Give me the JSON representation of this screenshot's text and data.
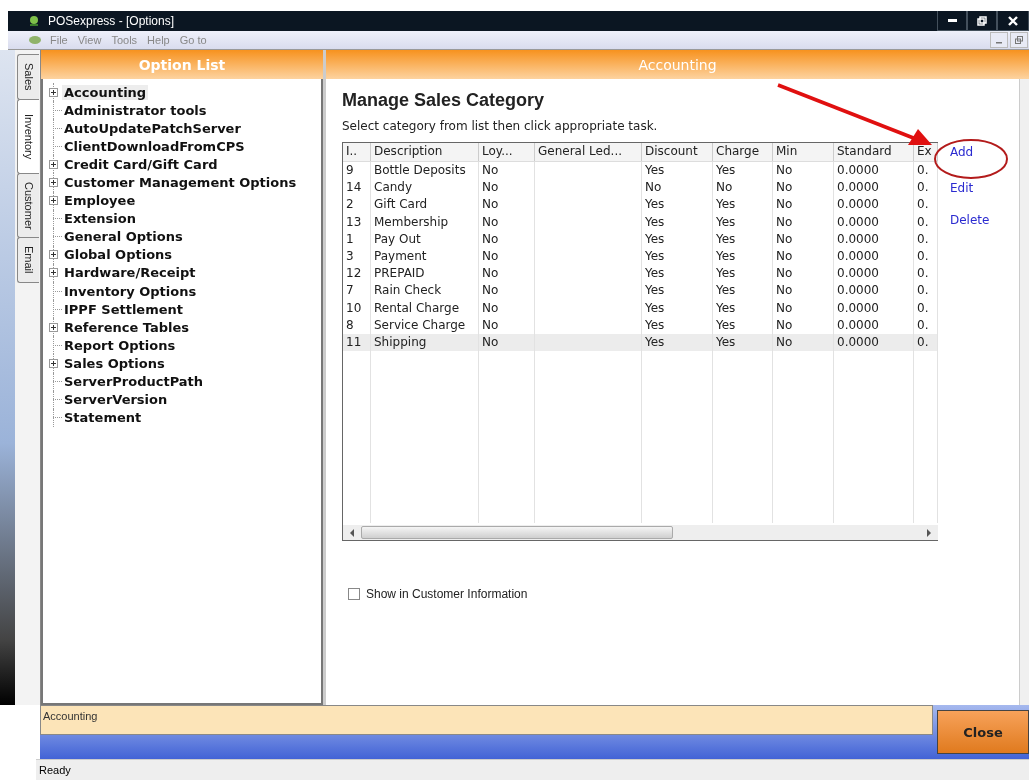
{
  "window": {
    "title": "POSexpress - [Options]"
  },
  "menu": [
    "File",
    "View",
    "Tools",
    "Help",
    "Go to"
  ],
  "side_tabs": [
    {
      "label": "Sales",
      "selected": false
    },
    {
      "label": "Inventory",
      "selected": true
    },
    {
      "label": "Customer",
      "selected": false
    },
    {
      "label": "Email",
      "selected": false
    }
  ],
  "option_list": {
    "title": "Option List",
    "items": [
      {
        "label": "Accounting",
        "expandable": true,
        "selected": true
      },
      {
        "label": "Administrator tools",
        "expandable": false,
        "selected": false
      },
      {
        "label": "AutoUpdatePatchServer",
        "expandable": false,
        "selected": false
      },
      {
        "label": "ClientDownloadFromCPS",
        "expandable": false,
        "selected": false
      },
      {
        "label": "Credit Card/Gift Card",
        "expandable": true,
        "selected": false
      },
      {
        "label": "Customer Management Options",
        "expandable": true,
        "selected": false
      },
      {
        "label": "Employee",
        "expandable": true,
        "selected": false
      },
      {
        "label": "Extension",
        "expandable": false,
        "selected": false
      },
      {
        "label": "General Options",
        "expandable": false,
        "selected": false
      },
      {
        "label": "Global Options",
        "expandable": true,
        "selected": false
      },
      {
        "label": "Hardware/Receipt",
        "expandable": true,
        "selected": false
      },
      {
        "label": "Inventory Options",
        "expandable": false,
        "selected": false
      },
      {
        "label": "IPPF Settlement",
        "expandable": false,
        "selected": false
      },
      {
        "label": "Reference Tables",
        "expandable": true,
        "selected": false
      },
      {
        "label": "Report Options",
        "expandable": false,
        "selected": false
      },
      {
        "label": "Sales Options",
        "expandable": true,
        "selected": false
      },
      {
        "label": "ServerProductPath",
        "expandable": false,
        "selected": false
      },
      {
        "label": "ServerVersion",
        "expandable": false,
        "selected": false
      },
      {
        "label": "Statement",
        "expandable": false,
        "selected": false
      }
    ]
  },
  "content": {
    "header": "Accounting",
    "heading": "Manage Sales Category",
    "instruction": "Select category  from list then click appropriate task.",
    "table": {
      "columns": [
        "I..",
        "Description",
        "Loy...",
        "General Led...",
        "Discount",
        "Charge",
        "Min",
        "Standard",
        "Ex"
      ],
      "rows": [
        {
          "cells": [
            "9",
            "Bottle Deposits",
            "No",
            "",
            "Yes",
            "Yes",
            "No",
            "0.0000",
            "0."
          ],
          "selected": false
        },
        {
          "cells": [
            "14",
            "Candy",
            "No",
            "",
            "No",
            "No",
            "No",
            "0.0000",
            "0."
          ],
          "selected": false
        },
        {
          "cells": [
            "2",
            "Gift Card",
            "No",
            "",
            "Yes",
            "Yes",
            "No",
            "0.0000",
            "0."
          ],
          "selected": false
        },
        {
          "cells": [
            "13",
            "Membership",
            "No",
            "",
            "Yes",
            "Yes",
            "No",
            "0.0000",
            "0."
          ],
          "selected": false
        },
        {
          "cells": [
            "1",
            "Pay Out",
            "No",
            "",
            "Yes",
            "Yes",
            "No",
            "0.0000",
            "0."
          ],
          "selected": false
        },
        {
          "cells": [
            "3",
            "Payment",
            "No",
            "",
            "Yes",
            "Yes",
            "No",
            "0.0000",
            "0."
          ],
          "selected": false
        },
        {
          "cells": [
            "12",
            "PREPAID",
            "No",
            "",
            "Yes",
            "Yes",
            "No",
            "0.0000",
            "0."
          ],
          "selected": false
        },
        {
          "cells": [
            "7",
            "Rain Check",
            "No",
            "",
            "Yes",
            "Yes",
            "No",
            "0.0000",
            "0."
          ],
          "selected": false
        },
        {
          "cells": [
            "10",
            "Rental Charge",
            "No",
            "",
            "Yes",
            "Yes",
            "No",
            "0.0000",
            "0."
          ],
          "selected": false
        },
        {
          "cells": [
            "8",
            "Service Charge",
            "No",
            "",
            "Yes",
            "Yes",
            "No",
            "0.0000",
            "0."
          ],
          "selected": false
        },
        {
          "cells": [
            "11",
            "Shipping",
            "No",
            "",
            "Yes",
            "Yes",
            "No",
            "0.0000",
            "0."
          ],
          "selected": true
        }
      ]
    },
    "actions": [
      "Add",
      "Edit",
      "Delete"
    ],
    "checkbox": {
      "label": "Show in Customer Information",
      "checked": false
    }
  },
  "footer": {
    "field": "Accounting",
    "close": "Close"
  },
  "status_bar": "Ready"
}
